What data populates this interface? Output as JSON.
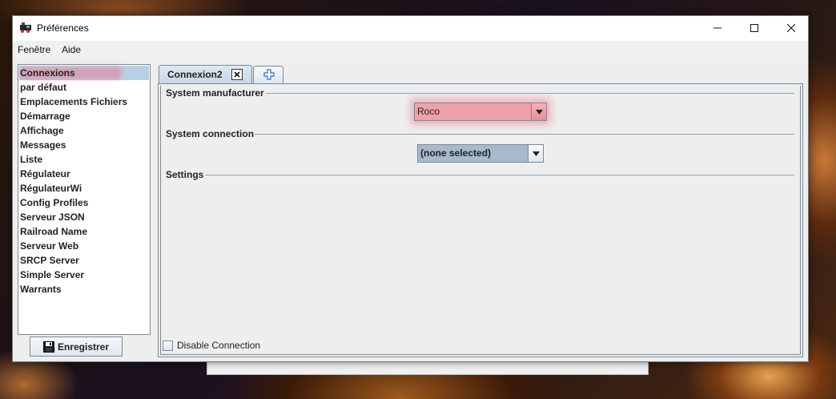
{
  "window": {
    "title": "Préférences"
  },
  "menubar": {
    "items": [
      "Fenêtre",
      "Aide"
    ]
  },
  "sidebar": {
    "selected_index": 0,
    "items": [
      "Connexions",
      "par défaut",
      "Emplacements Fichiers",
      "Démarrage",
      "Affichage",
      "Messages",
      "Liste",
      "Régulateur",
      "RégulateurWi",
      "Config Profiles",
      "Serveur JSON",
      "Railroad Name",
      "Serveur Web",
      "SRCP Server",
      "Simple Server",
      "Warrants"
    ],
    "save_label": "Enregistrer"
  },
  "tabs": {
    "active_label": "Connexion2"
  },
  "panel": {
    "system_manufacturer_label": "System manufacturer",
    "system_manufacturer_value": "Roco",
    "system_connection_label": "System connection",
    "system_connection_value": "(none selected)",
    "settings_label": "Settings",
    "disable_connection_label": "Disable Connection",
    "disable_connection_checked": false
  },
  "colors": {
    "selection": "#b8cfe5",
    "highlight": "#f0a0a8",
    "combo_none": "#a7b9cc"
  }
}
